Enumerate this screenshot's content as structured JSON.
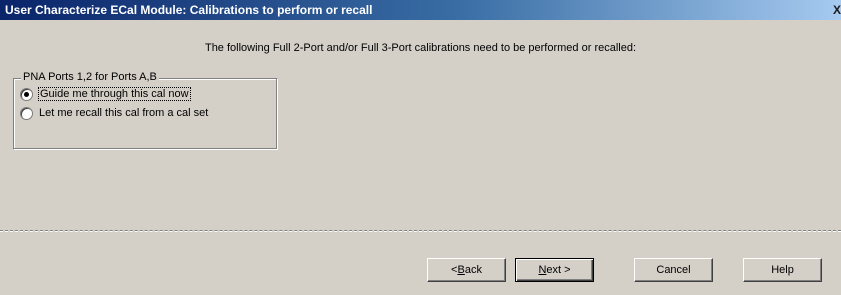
{
  "window": {
    "title": "User Characterize ECal Module: Calibrations to perform or recall",
    "close_glyph": "X"
  },
  "message": "The following Full 2-Port and/or Full 3-Port calibrations need to be performed or recalled:",
  "group": {
    "legend": "PNA Ports 1,2 for Ports A,B",
    "options": [
      {
        "label": "Guide me through this cal now",
        "selected": true
      },
      {
        "label": "Let me recall this cal from a cal set",
        "selected": false
      }
    ]
  },
  "buttons": {
    "back": {
      "prefix": "< ",
      "mnemonic": "B",
      "rest": "ack"
    },
    "next": {
      "mnemonic": "N",
      "rest": "ext >"
    },
    "cancel": "Cancel",
    "help": "Help"
  }
}
